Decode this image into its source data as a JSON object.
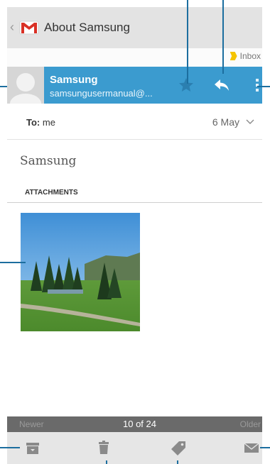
{
  "action_bar": {
    "back_icon": "chevron-left-icon",
    "app_icon": "gmail-icon",
    "title": "About Samsung"
  },
  "label": {
    "name": "Inbox",
    "color": "#f5c400"
  },
  "sender": {
    "name": "Samsung",
    "email": "samsungusermanual@...",
    "header_color": "#3b9bcf"
  },
  "recipient": {
    "to_label": "To:",
    "to_value": "me",
    "date": "6 May"
  },
  "message": {
    "body": "Samsung",
    "attachments_heading": "ATTACHMENTS"
  },
  "pager": {
    "newer": "Newer",
    "count": "10 of 24",
    "older": "Older"
  },
  "toolbar": {
    "icons": [
      "archive-icon",
      "delete-icon",
      "label-icon",
      "mark-unread-icon"
    ]
  }
}
